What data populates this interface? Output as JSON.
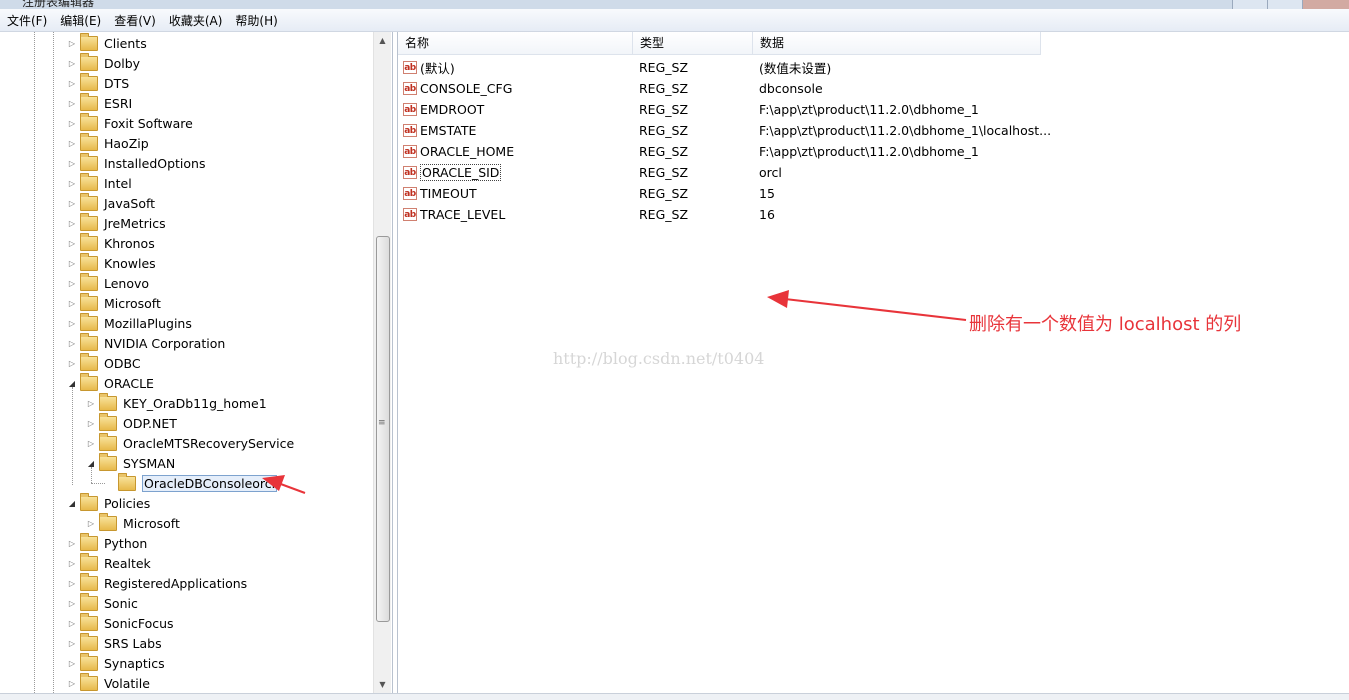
{
  "window": {
    "title": "注册表编辑器"
  },
  "menu": [
    "文件(F)",
    "编辑(E)",
    "查看(V)",
    "收藏夹(A)",
    "帮助(H)"
  ],
  "tree": {
    "top_items": [
      "Clients",
      "Dolby",
      "DTS",
      "ESRI",
      "Foxit Software",
      "HaoZip",
      "InstalledOptions",
      "Intel",
      "JavaSoft",
      "JreMetrics",
      "Khronos",
      "Knowles",
      "Lenovo",
      "Microsoft",
      "MozillaPlugins",
      "NVIDIA Corporation",
      "ODBC",
      "ORACLE"
    ],
    "oracle_children": [
      "KEY_OraDb11g_home1",
      "ODP.NET",
      "OracleMTSRecoveryService",
      "SYSMAN"
    ],
    "sysman_children": [
      "OracleDBConsoleorcl"
    ],
    "policies": "Policies",
    "policies_children": [
      "Microsoft"
    ],
    "bottom_items": [
      "Python",
      "Realtek",
      "RegisteredApplications",
      "Sonic",
      "SonicFocus",
      "SRS Labs",
      "Synaptics",
      "Volatile"
    ]
  },
  "values_pane": {
    "columns": [
      "名称",
      "类型",
      "数据"
    ],
    "rows": [
      {
        "name": "(默认)",
        "type": "REG_SZ",
        "data": "(数值未设置)"
      },
      {
        "name": "CONSOLE_CFG",
        "type": "REG_SZ",
        "data": "dbconsole"
      },
      {
        "name": "EMDROOT",
        "type": "REG_SZ",
        "data": "F:\\app\\zt\\product\\11.2.0\\dbhome_1"
      },
      {
        "name": "EMSTATE",
        "type": "REG_SZ",
        "data": "F:\\app\\zt\\product\\11.2.0\\dbhome_1\\localhost..."
      },
      {
        "name": "ORACLE_HOME",
        "type": "REG_SZ",
        "data": "F:\\app\\zt\\product\\11.2.0\\dbhome_1"
      },
      {
        "name": "ORACLE_SID",
        "type": "REG_SZ",
        "data": "orcl"
      },
      {
        "name": "TIMEOUT",
        "type": "REG_SZ",
        "data": "15"
      },
      {
        "name": "TRACE_LEVEL",
        "type": "REG_SZ",
        "data": "16"
      }
    ],
    "value_icon": "ab"
  },
  "annotation": {
    "text": "删除有一个数值为 localhost 的列",
    "color": "#e8343a"
  },
  "watermark": "http://blog.csdn.net/t0404",
  "icons": {
    "folder": "folder-icon",
    "string_value": "reg-sz-icon",
    "expand": "triangle-right-icon",
    "collapse": "triangle-down-icon"
  }
}
